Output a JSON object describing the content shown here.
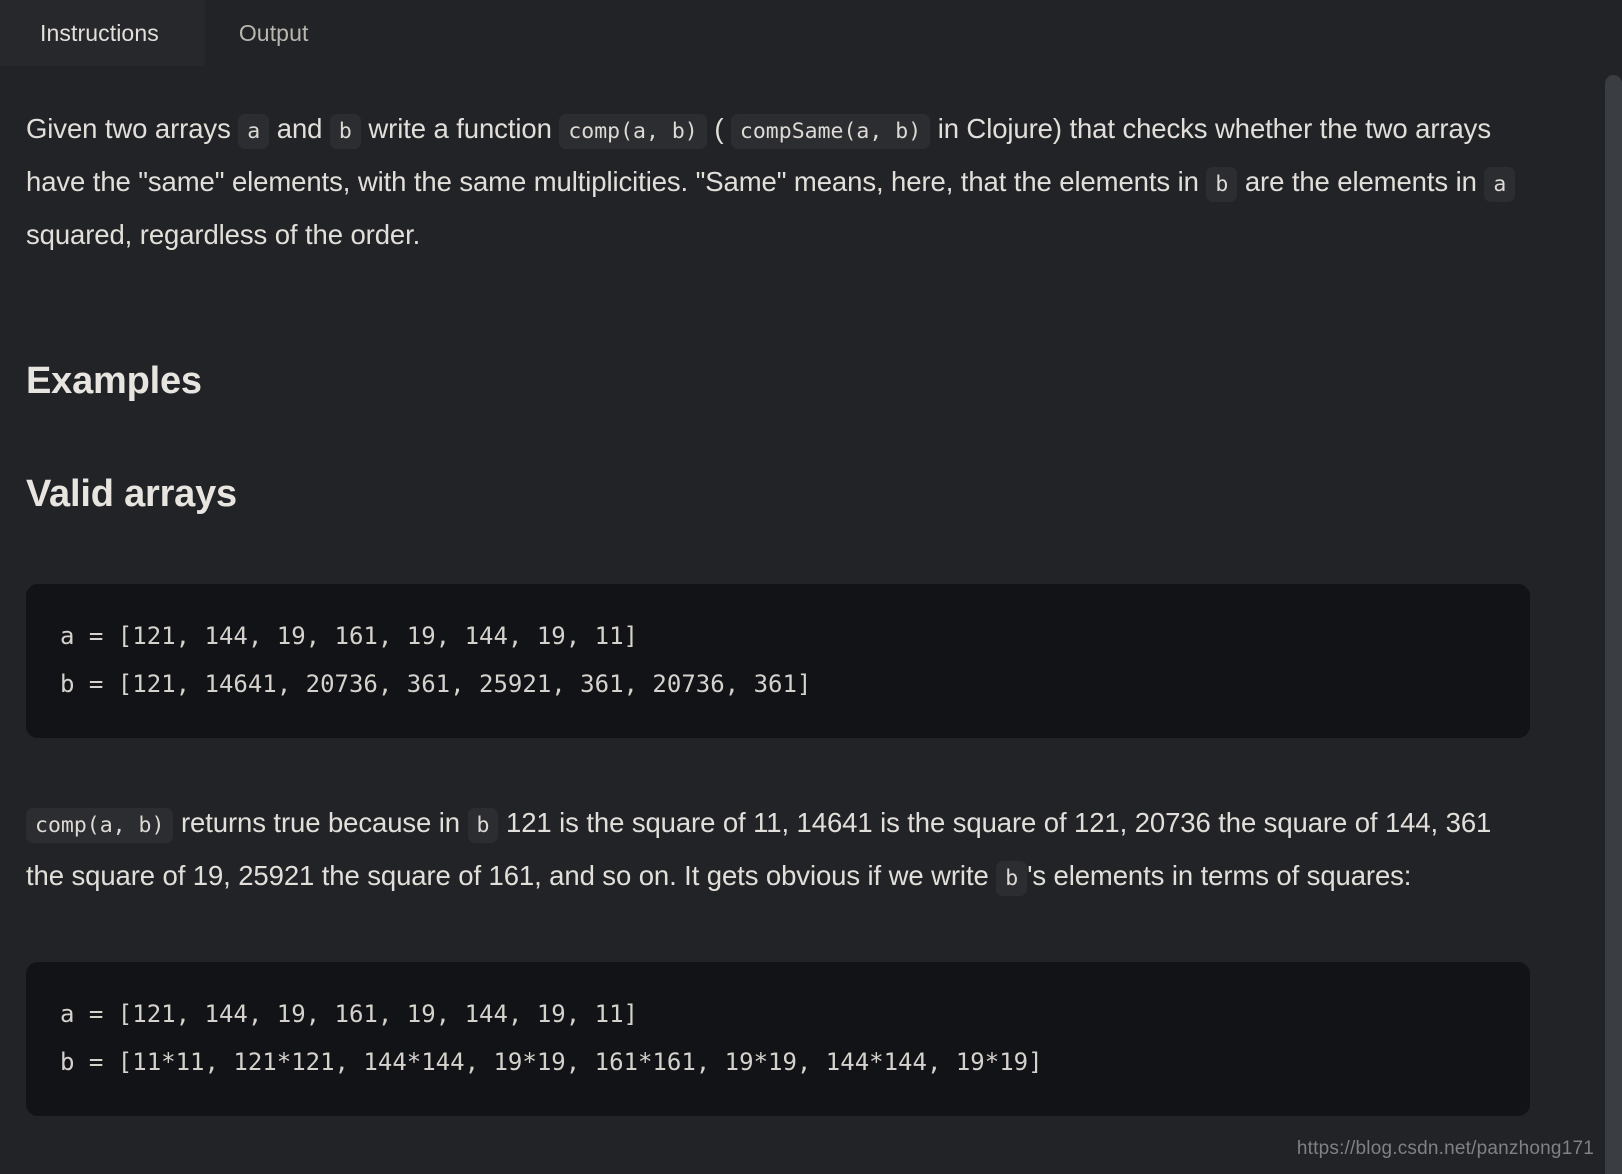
{
  "tabs": [
    {
      "label": "Instructions",
      "active": true
    },
    {
      "label": "Output",
      "active": false
    }
  ],
  "paragraph_1": {
    "s1": "Given two arrays",
    "c1": "a",
    "s2": "and",
    "c2": "b",
    "s3": "write a function",
    "c3": "comp(a, b)",
    "s4": "(",
    "c4": "compSame(a, b)",
    "s5": "in Clojure) that checks whether the two arrays have the \"same\" elements, with the same multiplicities. \"Same\" means, here, that the elements in",
    "c5": "b",
    "s6": "are the elements in",
    "c6": "a",
    "s7": "squared, regardless of the order."
  },
  "heading_examples": "Examples",
  "heading_valid_arrays": "Valid arrays",
  "code_block_1": "a = [121, 144, 19, 161, 19, 144, 19, 11]\nb = [121, 14641, 20736, 361, 25921, 361, 20736, 361]",
  "paragraph_2": {
    "c1": "comp(a, b)",
    "s1": "returns true because in",
    "c2": "b",
    "s2": "121 is the square of 11, 14641 is the square of 121, 20736 the square of 144, 361 the square of 19, 25921 the square of 161, and so on. It gets obvious if we write",
    "c3": "b",
    "s3": "'s elements in terms of squares:"
  },
  "code_block_2": "a = [121, 144, 19, 161, 19, 144, 19, 11]\nb = [11*11, 121*121, 144*144, 19*19, 161*161, 19*19, 144*144, 19*19]",
  "watermark": "https://blog.csdn.net/panzhong171",
  "colors": {
    "page_background": "#212326",
    "active_tab_background": "#26282b",
    "code_block_background": "#121316",
    "inline_code_background": "#2b2d31",
    "text": "#e2dfda",
    "scrollbar_thumb": "#3a3d41"
  }
}
